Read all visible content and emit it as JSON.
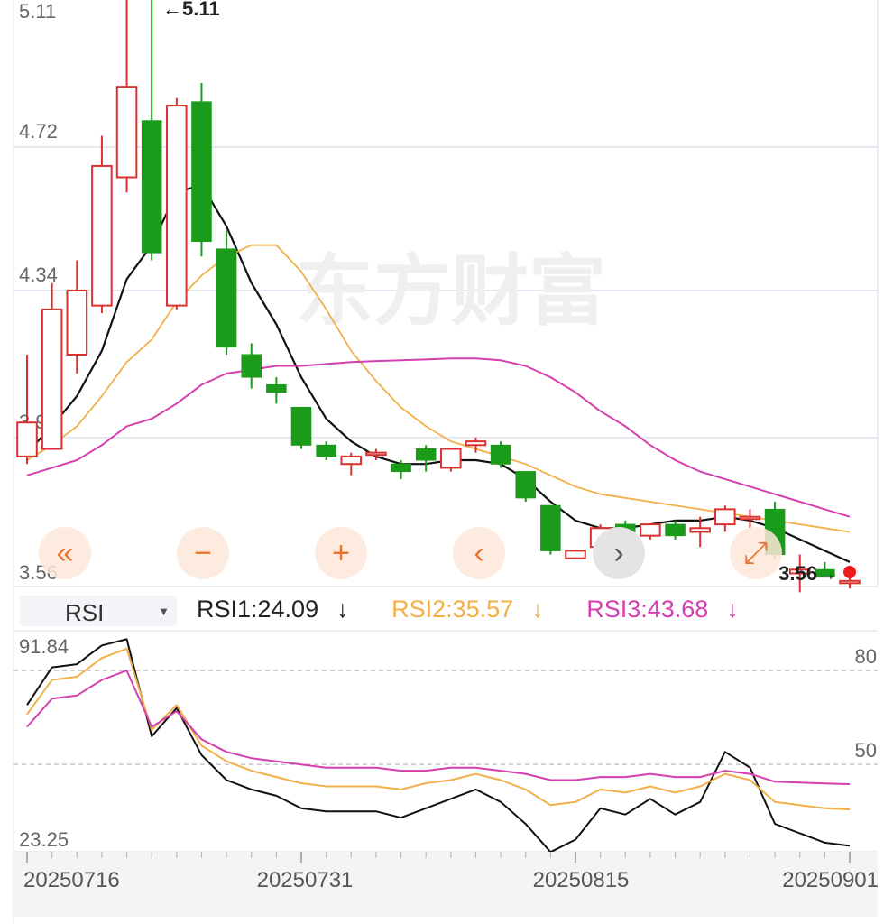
{
  "watermark": "东方财富",
  "colors": {
    "up": "#d9312f",
    "down": "#1a9b1a",
    "ma1": "#111111",
    "ma2": "#f2b04a",
    "ma3": "#d63fb0",
    "grid": "#dde0ee",
    "axis_text": "#666666",
    "accent": "#e8742f",
    "marker": "#f21b1b"
  },
  "controls": [
    {
      "name": "scroll-left-fast-button",
      "icon": "double-chevron-left-icon",
      "glyph": "«",
      "style": "peach"
    },
    {
      "name": "zoom-out-button",
      "icon": "minus-icon",
      "glyph": "−",
      "style": "peach"
    },
    {
      "name": "zoom-in-button",
      "icon": "plus-icon",
      "glyph": "+",
      "style": "peach"
    },
    {
      "name": "scroll-left-button",
      "icon": "chevron-left-icon",
      "glyph": "‹",
      "style": "peach"
    },
    {
      "name": "scroll-right-button",
      "icon": "chevron-right-icon",
      "glyph": "›",
      "style": "gray"
    },
    {
      "name": "fullscreen-button",
      "icon": "expand-arrows-icon",
      "glyph": "⤢",
      "style": "peach"
    }
  ],
  "indicator": {
    "selected": "RSI",
    "rsi1_label": "RSI1:24.09",
    "rsi2_label": "RSI2:35.57",
    "rsi3_label": "RSI3:43.68",
    "trend_arrow": "↓"
  },
  "chart_data": [
    {
      "type": "candlestick",
      "title": "",
      "y_ticks": [
        "5.11",
        "4.72",
        "4.34",
        "3.95",
        "3.56"
      ],
      "ylim": [
        3.56,
        5.11
      ],
      "grid": true,
      "annotations": {
        "high": "←5.11",
        "last": "3.56→"
      },
      "candles": [
        {
          "o": 3.9,
          "h": 4.17,
          "l": 3.88,
          "c": 3.99
        },
        {
          "o": 3.92,
          "h": 4.36,
          "l": 3.92,
          "c": 4.29
        },
        {
          "o": 4.17,
          "h": 4.42,
          "l": 4.12,
          "c": 4.34
        },
        {
          "o": 4.3,
          "h": 4.75,
          "l": 4.28,
          "c": 4.67
        },
        {
          "o": 4.64,
          "h": 5.18,
          "l": 4.6,
          "c": 4.88
        },
        {
          "o": 4.79,
          "h": 5.11,
          "l": 4.42,
          "c": 4.44
        },
        {
          "o": 4.3,
          "h": 4.85,
          "l": 4.29,
          "c": 4.83
        },
        {
          "o": 4.84,
          "h": 4.89,
          "l": 4.43,
          "c": 4.47
        },
        {
          "o": 4.45,
          "h": 4.5,
          "l": 4.17,
          "c": 4.19
        },
        {
          "o": 4.17,
          "h": 4.2,
          "l": 4.08,
          "c": 4.11
        },
        {
          "o": 4.09,
          "h": 4.11,
          "l": 4.04,
          "c": 4.07
        },
        {
          "o": 4.03,
          "h": 4.03,
          "l": 3.92,
          "c": 3.93
        },
        {
          "o": 3.93,
          "h": 3.94,
          "l": 3.89,
          "c": 3.9
        },
        {
          "o": 3.88,
          "h": 3.91,
          "l": 3.85,
          "c": 3.9
        },
        {
          "o": 3.91,
          "h": 3.92,
          "l": 3.89,
          "c": 3.91
        },
        {
          "o": 3.88,
          "h": 3.89,
          "l": 3.84,
          "c": 3.86
        },
        {
          "o": 3.92,
          "h": 3.93,
          "l": 3.86,
          "c": 3.89
        },
        {
          "o": 3.87,
          "h": 3.92,
          "l": 3.86,
          "c": 3.92
        },
        {
          "o": 3.93,
          "h": 3.95,
          "l": 3.91,
          "c": 3.94
        },
        {
          "o": 3.93,
          "h": 3.94,
          "l": 3.87,
          "c": 3.88
        },
        {
          "o": 3.86,
          "h": 3.86,
          "l": 3.78,
          "c": 3.79
        },
        {
          "o": 3.77,
          "h": 3.77,
          "l": 3.64,
          "c": 3.65
        },
        {
          "o": 3.63,
          "h": 3.65,
          "l": 3.63,
          "c": 3.65
        },
        {
          "o": 3.66,
          "h": 3.72,
          "l": 3.65,
          "c": 3.71
        },
        {
          "o": 3.72,
          "h": 3.73,
          "l": 3.69,
          "c": 3.7
        },
        {
          "o": 3.69,
          "h": 3.72,
          "l": 3.68,
          "c": 3.72
        },
        {
          "o": 3.72,
          "h": 3.73,
          "l": 3.68,
          "c": 3.69
        },
        {
          "o": 3.7,
          "h": 3.74,
          "l": 3.66,
          "c": 3.71
        },
        {
          "o": 3.72,
          "h": 3.77,
          "l": 3.7,
          "c": 3.76
        },
        {
          "o": 3.74,
          "h": 3.76,
          "l": 3.71,
          "c": 3.74
        },
        {
          "o": 3.76,
          "h": 3.78,
          "l": 3.63,
          "c": 3.64
        },
        {
          "o": 3.59,
          "h": 3.64,
          "l": 3.54,
          "c": 3.6
        },
        {
          "o": 3.6,
          "h": 3.62,
          "l": 3.58,
          "c": 3.58
        },
        {
          "o": 3.57,
          "h": 3.61,
          "l": 3.55,
          "c": 3.57
        }
      ],
      "series": [
        {
          "values": [
            3.91,
            3.98,
            4.06,
            4.18,
            4.37,
            4.46,
            4.6,
            4.62,
            4.51,
            4.36,
            4.25,
            4.11,
            4.0,
            3.94,
            3.9,
            3.88,
            3.88,
            3.89,
            3.89,
            3.88,
            3.84,
            3.78,
            3.73,
            3.71,
            3.71,
            3.72,
            3.73,
            3.73,
            3.74,
            3.73,
            3.71,
            3.68,
            3.65,
            3.62
          ]
        },
        {
          "values": [
            3.89,
            3.93,
            3.98,
            4.06,
            4.15,
            4.21,
            4.31,
            4.38,
            4.43,
            4.46,
            4.46,
            4.39,
            4.29,
            4.18,
            4.1,
            4.03,
            3.98,
            3.94,
            3.92,
            3.9,
            3.88,
            3.85,
            3.82,
            3.8,
            3.79,
            3.78,
            3.77,
            3.76,
            3.75,
            3.74,
            3.73,
            3.72,
            3.71,
            3.7
          ]
        },
        {
          "values": [
            3.85,
            3.87,
            3.89,
            3.93,
            3.98,
            4.0,
            4.04,
            4.09,
            4.12,
            4.13,
            4.14,
            4.14,
            4.145,
            4.15,
            4.153,
            4.155,
            4.157,
            4.16,
            4.16,
            4.155,
            4.14,
            4.11,
            4.07,
            4.02,
            3.98,
            3.93,
            3.89,
            3.86,
            3.84,
            3.82,
            3.8,
            3.78,
            3.76,
            3.74
          ]
        }
      ]
    },
    {
      "type": "line",
      "title": "RSI",
      "y_ticks": [
        "91.84",
        "23.25"
      ],
      "ylim": [
        23.25,
        91.84
      ],
      "reference_lines": [
        {
          "value": 80,
          "label": "80"
        },
        {
          "value": 50,
          "label": "50"
        }
      ],
      "x_tick_labels": [
        "20250716",
        "20250731",
        "20250815",
        "20250901"
      ],
      "series": [
        {
          "name": "RSI1",
          "values": [
            69.0,
            81.0,
            82.0,
            88.0,
            90.0,
            59.0,
            68.0,
            53.0,
            45.0,
            42.0,
            40.0,
            36.0,
            35.0,
            35.0,
            35.0,
            33.0,
            36.0,
            39.0,
            42.0,
            38.0,
            31.0,
            22.0,
            26.0,
            36.0,
            34.0,
            39.0,
            34.0,
            38.0,
            54.0,
            49.0,
            31.0,
            28.0,
            25.0,
            24.0
          ]
        },
        {
          "name": "RSI2",
          "values": [
            66.0,
            77.0,
            78.0,
            84.0,
            87.0,
            61.0,
            69.0,
            56.0,
            51.0,
            48.0,
            46.0,
            44.0,
            43.0,
            43.0,
            43.0,
            42.0,
            44.0,
            45.0,
            47.0,
            45.0,
            42.0,
            37.0,
            38.0,
            42.0,
            41.0,
            43.0,
            41.0,
            43.0,
            47.0,
            45.0,
            38.0,
            37.0,
            36.0,
            35.6
          ]
        },
        {
          "name": "RSI3",
          "values": [
            62.0,
            71.0,
            72.0,
            77.0,
            80.0,
            62.0,
            67.0,
            58.0,
            54.0,
            52.0,
            51.0,
            50.0,
            49.0,
            49.0,
            49.0,
            48.0,
            48.0,
            49.0,
            49.0,
            48.0,
            47.0,
            45.0,
            45.0,
            46.0,
            46.0,
            47.0,
            46.0,
            46.0,
            48.0,
            47.0,
            44.5,
            44.2,
            43.9,
            43.7
          ]
        }
      ]
    }
  ]
}
